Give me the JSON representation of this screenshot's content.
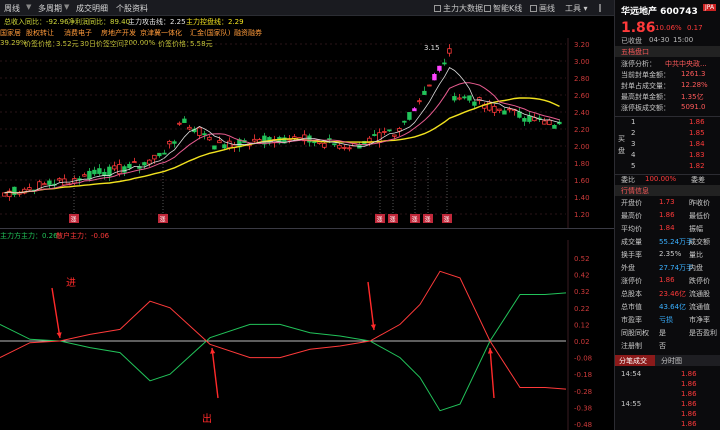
{
  "toolbar": {
    "items": [
      "周线",
      "多周期",
      "成交明细",
      "个股资料"
    ],
    "right": [
      "主力大数据",
      "智能K线",
      "画线",
      "工具"
    ]
  },
  "info_bar": {
    "t1": "总收入同比：-92.96",
    "t2": "净利润同比：89.40",
    "t3": "主力攻击线：2.25",
    "t4": "主力控盘线：2.29"
  },
  "concepts": [
    "国家居",
    "股权转让",
    "消费电子",
    "房地产开发",
    "京津冀一体化",
    "汇金(国家队)",
    "融资融券"
  ],
  "stats_line": {
    "a": "39.29%",
    "b_label": "价签价格：",
    "b_val": "3.52元",
    "c_label": "30日价签空间：",
    "c_val": "200.00%",
    "d_label": "价签价格：",
    "d_val": "5.58元"
  },
  "main_chart": {
    "y_ticks": [
      "3.20",
      "3.00",
      "2.80",
      "2.60",
      "2.40",
      "2.20",
      "2.00",
      "1.80",
      "1.60",
      "1.40",
      "1.20"
    ],
    "y_values": [
      3.2,
      3.0,
      2.8,
      2.6,
      2.4,
      2.2,
      2.0,
      1.8,
      1.6,
      1.4,
      1.2
    ],
    "peak_label": "3.15",
    "marker_text": "涨"
  },
  "sub_chart": {
    "title_a": "主力方主力：0.26",
    "title_b": "散户主力：-0.06",
    "y_ticks": [
      "0.52",
      "0.42",
      "0.32",
      "0.22",
      "0.12",
      "0.02",
      "-0.08",
      "-0.18",
      "-0.28",
      "-0.38",
      "-0.48"
    ],
    "y_values": [
      0.52,
      0.42,
      0.32,
      0.22,
      0.12,
      0.02,
      -0.08,
      -0.18,
      -0.28,
      -0.38,
      -0.48
    ],
    "label_in": "进",
    "label_out": "出"
  },
  "right_panel": {
    "name": "华远地产",
    "code": "600743",
    "price": "1.86",
    "chg_pct": "10.06%",
    "chg_abs": "0.17",
    "status": "已收盘",
    "date": "04-30",
    "time": "15:00",
    "section_title": "五档盘口",
    "analysis": [
      {
        "label": "涨停分析：",
        "val": "中共中央政..."
      },
      {
        "label": "当前封单金额：",
        "val": "1261.3"
      },
      {
        "label": "封单占成交量：",
        "val": "12.28%"
      },
      {
        "label": "最高封单金额：",
        "val": "1.35亿"
      },
      {
        "label": "涨停板成交额：",
        "val": "5091.0"
      }
    ],
    "sell_label": "买",
    "buy_label": "盘",
    "book": [
      {
        "lv": "1",
        "price": "1.86"
      },
      {
        "lv": "2",
        "price": "1.85"
      },
      {
        "lv": "3",
        "price": "1.84"
      },
      {
        "lv": "4",
        "price": "1.83"
      },
      {
        "lv": "5",
        "price": "1.82"
      }
    ],
    "weibi": {
      "l": "委比",
      "v": "100.00%",
      "r": "委差"
    },
    "section2": "行情信息",
    "quote": [
      {
        "l": "开盘价",
        "v": "1.73",
        "r": "昨收价"
      },
      {
        "l": "最高价",
        "v": "1.86",
        "r": "最低价"
      },
      {
        "l": "平均价",
        "v": "1.84",
        "r": "振幅"
      },
      {
        "l": "成交量",
        "v": "55.24万手",
        "r": "成交额"
      },
      {
        "l": "换手率",
        "v": "2.35%",
        "r": "量比"
      },
      {
        "l": "外盘",
        "v": "27.74万手",
        "r": "内盘"
      },
      {
        "l": "涨停价",
        "v": "1.86",
        "r": "跌停价"
      },
      {
        "l": "总股本",
        "v": "23.46亿",
        "r": "流通股"
      },
      {
        "l": "总市值",
        "v": "43.64亿",
        "r": "流通值"
      },
      {
        "l": "市盈率",
        "v": "亏损",
        "r": "市净率"
      },
      {
        "l": "同股同权",
        "v": "是",
        "r": "是否盈利"
      },
      {
        "l": "注册制",
        "v": "否",
        "r": ""
      }
    ],
    "tabs": [
      "分笔成交",
      "分时图"
    ],
    "trades": [
      {
        "t": "14:54",
        "p": "1.86"
      },
      {
        "t": "",
        "p": "1.86"
      },
      {
        "t": "",
        "p": "1.86"
      },
      {
        "t": "14:55",
        "p": "1.86"
      },
      {
        "t": "",
        "p": "1.86"
      },
      {
        "t": "",
        "p": "1.86"
      }
    ]
  },
  "colors": {
    "up": "#ff3a3a",
    "down": "#22c35a",
    "ma_yellow": "#f2e21f",
    "ma_white": "#dddddd",
    "ma_pink": "#e75b8f",
    "limit": "#ff44ff"
  }
}
